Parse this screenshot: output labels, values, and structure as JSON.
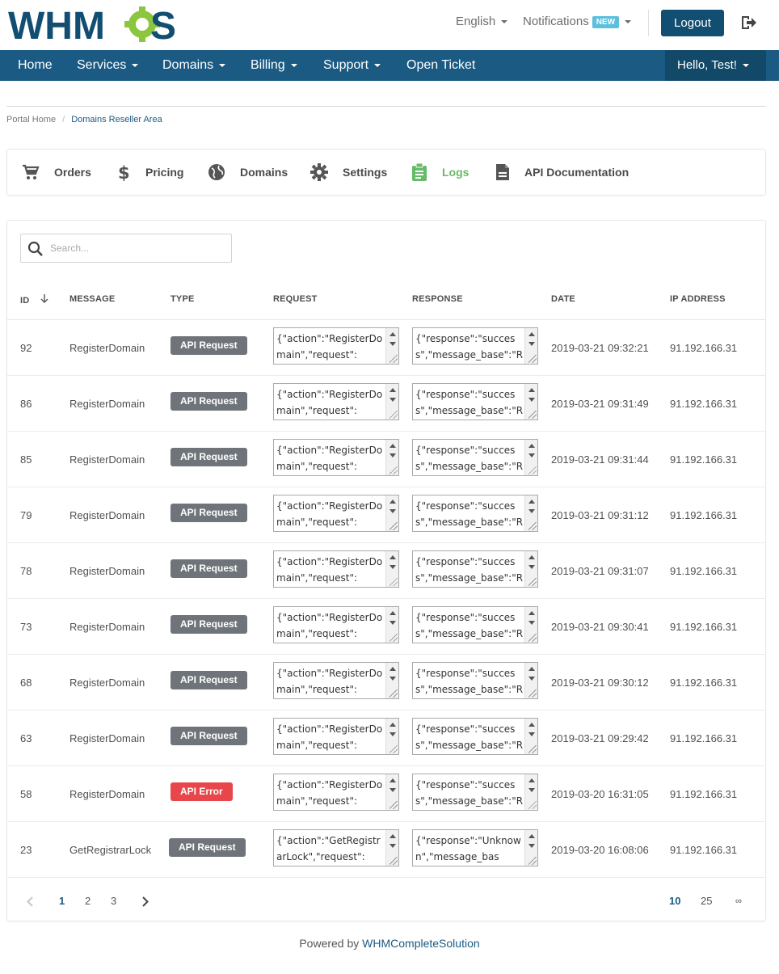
{
  "header": {
    "logo_text": "WHMCS",
    "language": "English",
    "notifications_label": "Notifications",
    "notifications_badge": "NEW",
    "logout_label": "Logout"
  },
  "nav": {
    "items": [
      "Home",
      "Services",
      "Domains",
      "Billing",
      "Support",
      "Open Ticket"
    ],
    "user_greeting": "Hello, Test!"
  },
  "breadcrumb": {
    "home": "Portal Home",
    "current": "Domains Reseller Area"
  },
  "tabs": [
    {
      "label": "Orders",
      "icon": "cart-icon"
    },
    {
      "label": "Pricing",
      "icon": "dollar-icon"
    },
    {
      "label": "Domains",
      "icon": "globe-icon"
    },
    {
      "label": "Settings",
      "icon": "gear-icon"
    },
    {
      "label": "Logs",
      "icon": "clipboard-icon",
      "active": true
    },
    {
      "label": "API Documentation",
      "icon": "document-icon"
    }
  ],
  "search": {
    "placeholder": "Search..."
  },
  "table": {
    "columns": [
      "ID",
      "MESSAGE",
      "TYPE",
      "REQUEST",
      "RESPONSE",
      "DATE",
      "IP ADDRESS"
    ],
    "rows": [
      {
        "id": "92",
        "message": "RegisterDomain",
        "type": "API Request",
        "status": "request",
        "request": "{\"action\":\"RegisterDomain\",\"request\":",
        "response": "{\"response\":\"success\",\"message_base\":\"Regis",
        "date": "2019-03-21 09:32:21",
        "ip": "91.192.166.31"
      },
      {
        "id": "86",
        "message": "RegisterDomain",
        "type": "API Request",
        "status": "request",
        "request": "{\"action\":\"RegisterDomain\",\"request\":",
        "response": "{\"response\":\"success\",\"message_base\":\"Regis",
        "date": "2019-03-21 09:31:49",
        "ip": "91.192.166.31"
      },
      {
        "id": "85",
        "message": "RegisterDomain",
        "type": "API Request",
        "status": "request",
        "request": "{\"action\":\"RegisterDomain\",\"request\":",
        "response": "{\"response\":\"success\",\"message_base\":\"Regis",
        "date": "2019-03-21 09:31:44",
        "ip": "91.192.166.31"
      },
      {
        "id": "79",
        "message": "RegisterDomain",
        "type": "API Request",
        "status": "request",
        "request": "{\"action\":\"RegisterDomain\",\"request\":",
        "response": "{\"response\":\"success\",\"message_base\":\"Regis",
        "date": "2019-03-21 09:31:12",
        "ip": "91.192.166.31"
      },
      {
        "id": "78",
        "message": "RegisterDomain",
        "type": "API Request",
        "status": "request",
        "request": "{\"action\":\"RegisterDomain\",\"request\":",
        "response": "{\"response\":\"success\",\"message_base\":\"Regis",
        "date": "2019-03-21 09:31:07",
        "ip": "91.192.166.31"
      },
      {
        "id": "73",
        "message": "RegisterDomain",
        "type": "API Request",
        "status": "request",
        "request": "{\"action\":\"RegisterDomain\",\"request\":",
        "response": "{\"response\":\"success\",\"message_base\":\"Regis",
        "date": "2019-03-21 09:30:41",
        "ip": "91.192.166.31"
      },
      {
        "id": "68",
        "message": "RegisterDomain",
        "type": "API Request",
        "status": "request",
        "request": "{\"action\":\"RegisterDomain\",\"request\":",
        "response": "{\"response\":\"success\",\"message_base\":\"Regis",
        "date": "2019-03-21 09:30:12",
        "ip": "91.192.166.31"
      },
      {
        "id": "63",
        "message": "RegisterDomain",
        "type": "API Request",
        "status": "request",
        "request": "{\"action\":\"RegisterDomain\",\"request\":",
        "response": "{\"response\":\"success\",\"message_base\":\"Regis",
        "date": "2019-03-21 09:29:42",
        "ip": "91.192.166.31"
      },
      {
        "id": "58",
        "message": "RegisterDomain",
        "type": "API Error",
        "status": "error",
        "request": "{\"action\":\"RegisterDomain\",\"request\":",
        "response": "{\"response\":\"success\",\"message_base\":\"Regis",
        "date": "2019-03-20 16:31:05",
        "ip": "91.192.166.31"
      },
      {
        "id": "23",
        "message": "GetRegistrarLock",
        "type": "API Request",
        "status": "request",
        "request": "{\"action\":\"GetRegistrarLock\",\"request\":",
        "response": "{\"response\":\"Unknown\",\"message_base\":\"GetR",
        "date": "2019-03-20 16:08:06",
        "ip": "91.192.166.31"
      }
    ]
  },
  "pagination": {
    "pages": [
      "1",
      "2",
      "3"
    ],
    "page_sizes": [
      "10",
      "25",
      "∞"
    ]
  },
  "footer": {
    "prefix": "Powered by",
    "link": "WHMCompleteSolution"
  },
  "colors": {
    "brand": "#1a5a83",
    "active_tab": "#66bb6a",
    "request_badge": "#6f747a",
    "error_badge": "#e8464a",
    "logo_green": "#8cc63f"
  }
}
